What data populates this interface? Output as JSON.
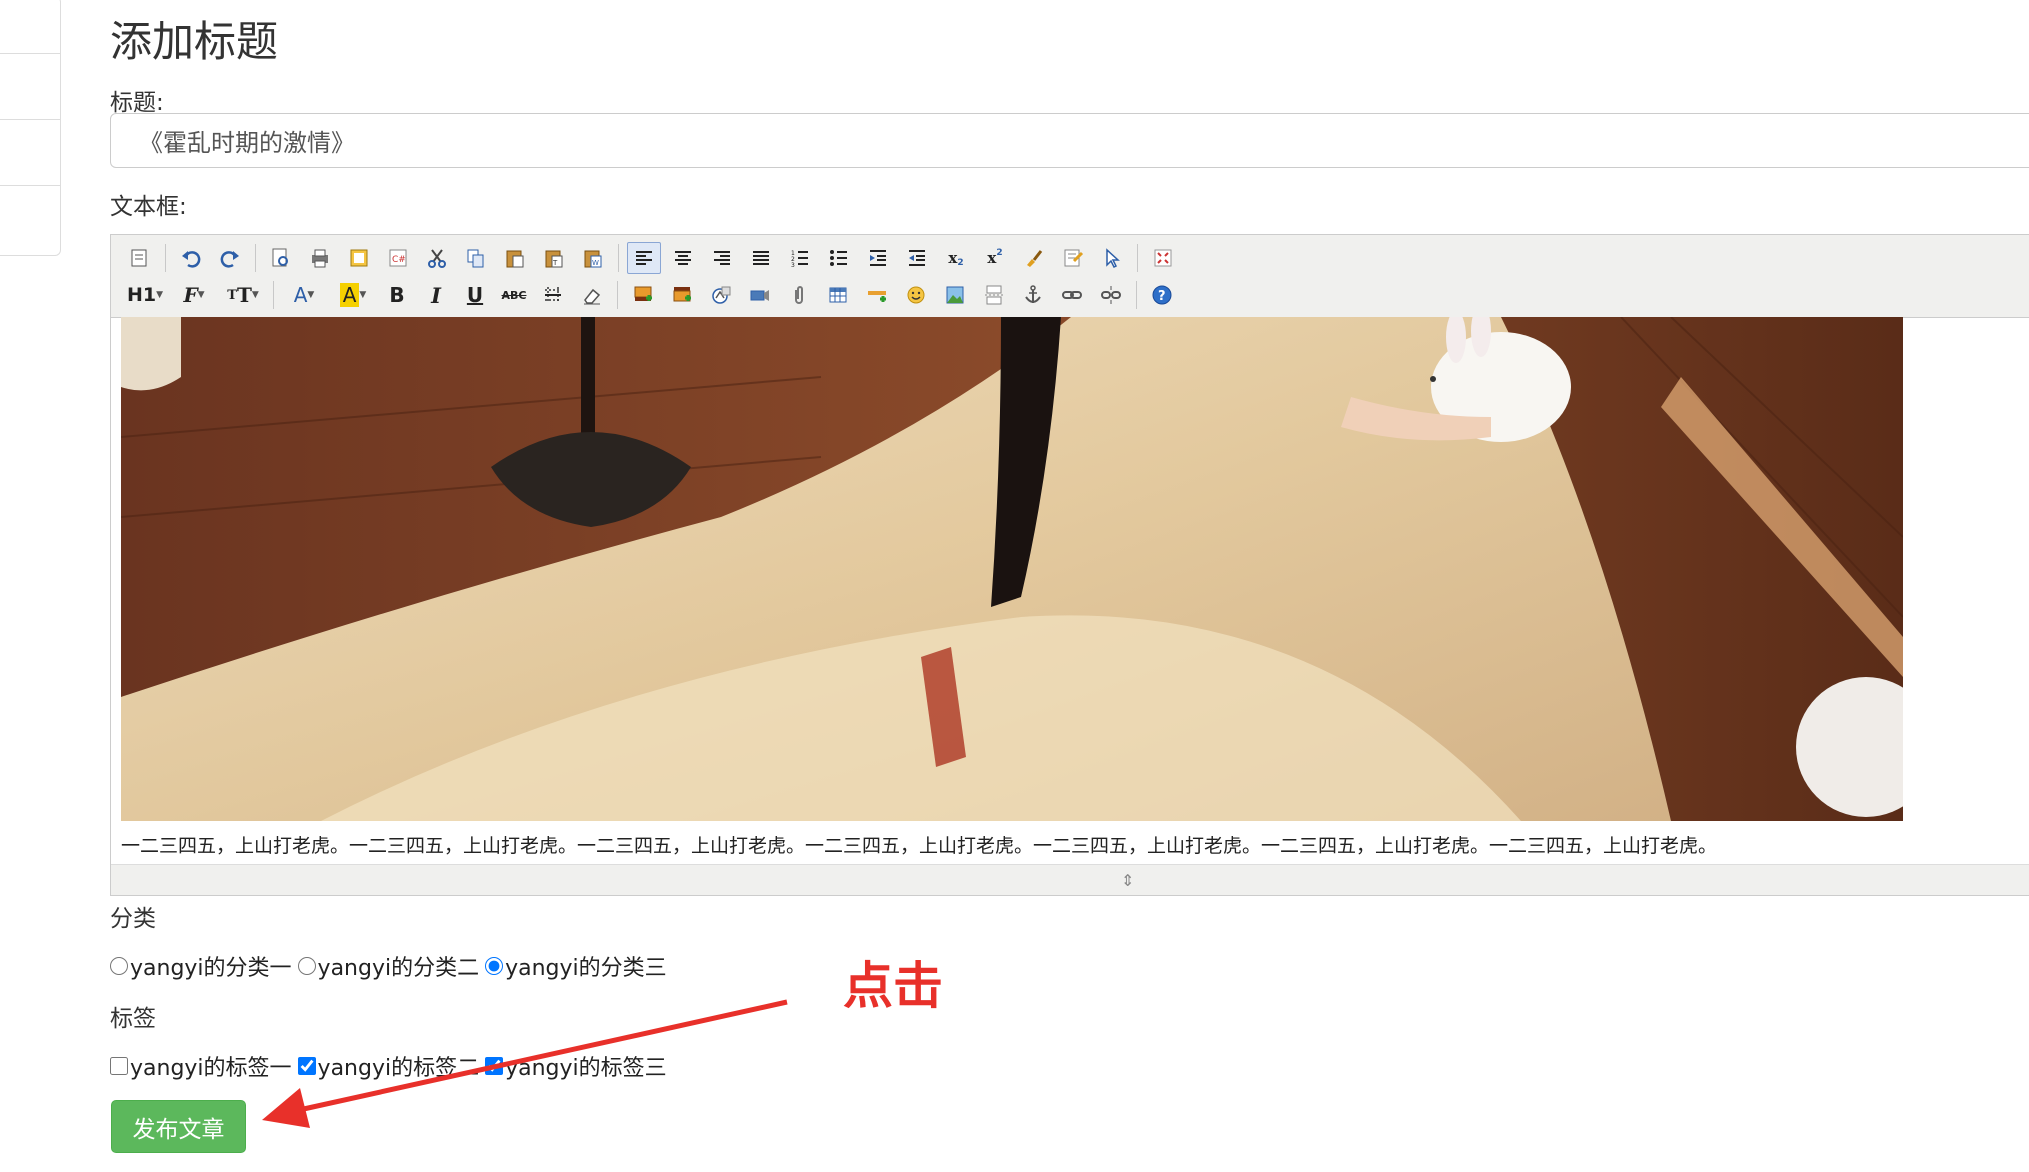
{
  "page": {
    "heading": "添加标题",
    "title_label": "标题:",
    "title_value": "《霍乱时期的激情》",
    "editor_label": "文本框:",
    "paragraph": "一二三四五，上山打老虎。一二三四五，上山打老虎。一二三四五，上山打老虎。一二三四五，上山打老虎。一二三四五，上山打老虎。一二三四五，上山打老虎。一二三四五，上山打老虎。",
    "category_label": "分类",
    "categories": [
      {
        "label": "yangyi的分类一",
        "checked": false
      },
      {
        "label": "yangyi的分类二",
        "checked": false
      },
      {
        "label": "yangyi的分类三",
        "checked": true
      }
    ],
    "tag_label": "标签",
    "tags": [
      {
        "label": "yangyi的标签一",
        "checked": false
      },
      {
        "label": "yangyi的标签二",
        "checked": true
      },
      {
        "label": "yangyi的标签三",
        "checked": true
      }
    ],
    "publish_button": "发布文章",
    "annotation": "点击"
  },
  "toolbar": {
    "h1": "H1",
    "font_family": "F",
    "font_size": "T",
    "bold": "B",
    "italic": "I",
    "underline": "U",
    "strike": "ABC",
    "color_a": "A",
    "subscript": "x",
    "superscript": "x"
  },
  "colors": {
    "publish_bg": "#5cb85c",
    "annotation": "#e8302a",
    "toolbar_bg": "#f0f0ee"
  }
}
